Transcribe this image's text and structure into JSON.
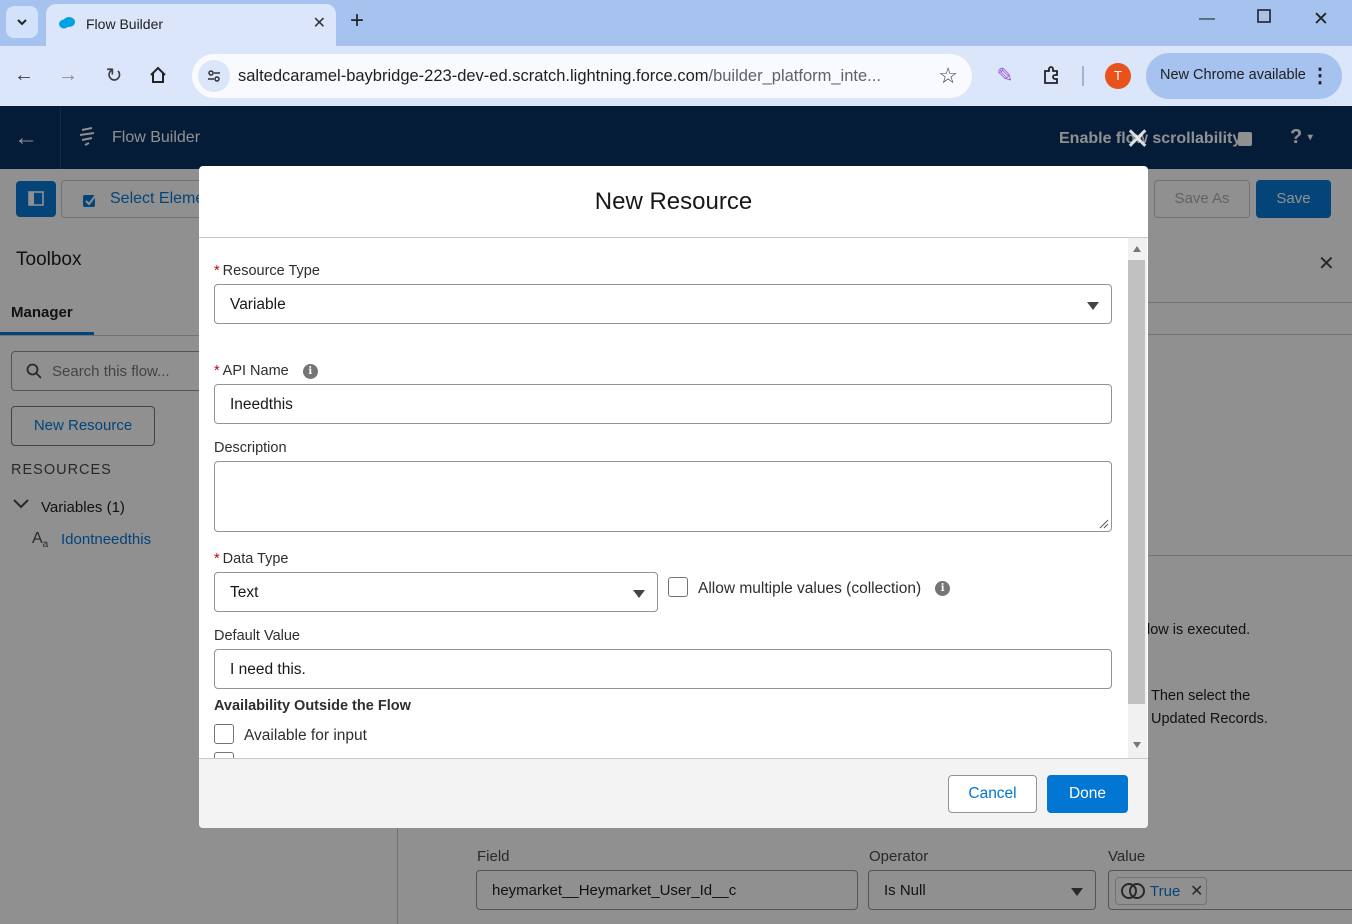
{
  "browser": {
    "tab_title": "Flow Builder",
    "url_main": "saltedcaramel-baybridge-223-dev-ed.scratch.lightning.force.com",
    "url_rest": "/builder_platform_inte...",
    "profile_initial": "T",
    "update_label": "New Chrome available"
  },
  "app_header": {
    "title": "Flow Builder",
    "scroll_label": "Enable flow scrollability",
    "help_label": "?"
  },
  "toolbar": {
    "select_label": "Select Eleme",
    "save_as_label": "Save As",
    "save_label": "Save"
  },
  "toolbox": {
    "title": "Toolbox",
    "tab_manager": "Manager",
    "search_placeholder": "Search this flow...",
    "new_resource_label": "New Resource",
    "resources_heading": "RESOURCES",
    "variables_label": "Variables (1)",
    "variable_item": "Idontneedthis"
  },
  "right_panel": {
    "text_1": "low is executed.",
    "text_2": "Then select the",
    "text_3": "Updated Records."
  },
  "condition_row": {
    "field_label": "Field",
    "field_value": "heymarket__Heymarket_User_Id__c",
    "operator_label": "Operator",
    "operator_value": "Is Null",
    "value_label": "Value",
    "value_pill": "True"
  },
  "modal": {
    "title": "New Resource",
    "resource_type_label": "Resource Type",
    "resource_type_value": "Variable",
    "api_name_label": "API Name",
    "api_name_value": "Ineedthis",
    "description_label": "Description",
    "description_value": "",
    "data_type_label": "Data Type",
    "data_type_value": "Text",
    "allow_multiple_label": "Allow multiple values (collection)",
    "default_value_label": "Default Value",
    "default_value_value": "I need this.",
    "availability_title": "Availability Outside the Flow",
    "available_input_label": "Available for input",
    "cancel_label": "Cancel",
    "done_label": "Done"
  },
  "colors": {
    "brand_blue": "#0176d3",
    "header_navy": "#032d60",
    "required_red": "#ba0517"
  }
}
